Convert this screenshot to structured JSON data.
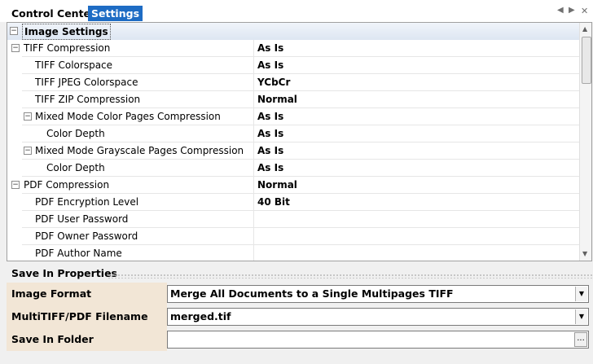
{
  "tabs": {
    "control_center": "Control Center",
    "settings": "Settings"
  },
  "grid": {
    "rows": [
      {
        "label": "Image Settings",
        "value": "",
        "category": true,
        "indent": 0
      },
      {
        "label": "TIFF Compression",
        "value": "As Is",
        "toggle": true,
        "indent": 1
      },
      {
        "label": "TIFF Colorspace",
        "value": "As Is",
        "indent": 2
      },
      {
        "label": "TIFF JPEG Colorspace",
        "value": "YCbCr",
        "indent": 2
      },
      {
        "label": "TIFF ZIP Compression",
        "value": "Normal",
        "indent": 2
      },
      {
        "label": "Mixed Mode Color Pages Compression",
        "value": "As Is",
        "toggle": true,
        "indent": 2
      },
      {
        "label": "Color Depth",
        "value": "As Is",
        "indent": 3
      },
      {
        "label": "Mixed Mode Grayscale Pages Compression",
        "value": "As Is",
        "toggle": true,
        "indent": 2
      },
      {
        "label": "Color Depth",
        "value": "As Is",
        "indent": 3
      },
      {
        "label": "PDF Compression",
        "value": "Normal",
        "toggle": true,
        "indent": 1
      },
      {
        "label": "PDF Encryption Level",
        "value": "40 Bit",
        "indent": 2
      },
      {
        "label": "PDF User Password",
        "value": "",
        "indent": 2
      },
      {
        "label": "PDF Owner Password",
        "value": "",
        "indent": 2
      },
      {
        "label": "PDF Author Name",
        "value": "",
        "indent": 2
      }
    ]
  },
  "save_in": {
    "title": "Save In Properties",
    "image_format_label": "Image Format",
    "image_format_value": "Merge All Documents to a Single Multipages TIFF",
    "filename_label": "MultiTIFF/PDF Filename",
    "filename_value": "merged.tif",
    "folder_label": "Save In Folder",
    "folder_value": "",
    "browse_label": "..."
  },
  "icons": {
    "nav_prev": "triangle-left-icon",
    "nav_next": "triangle-right-icon",
    "close": "close-icon",
    "collapse": "minus-box-icon",
    "dropdown": "triangle-down-icon"
  }
}
